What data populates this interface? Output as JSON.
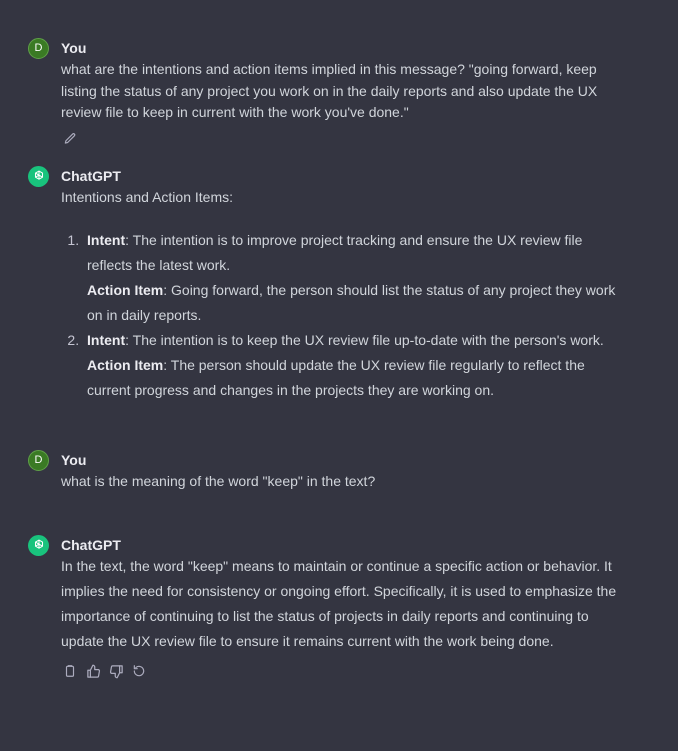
{
  "messages": [
    {
      "role": "user",
      "avatar_letter": "D",
      "author": "You",
      "text": "what are the intentions and action items implied in this message? \"going forward, keep listing the status of any project you work on in the daily reports and also update the UX review file to keep in current with the work you've done.\""
    },
    {
      "role": "assistant",
      "author": "ChatGPT",
      "intro": "Intentions and Action Items:",
      "items": [
        {
          "intent_label": "Intent",
          "intent_text": ": The intention is to improve project tracking and ensure the UX review file reflects the latest work.",
          "action_label": "Action Item",
          "action_text": ": Going forward, the person should list the status of any project they work on in daily reports."
        },
        {
          "intent_label": "Intent",
          "intent_text": ": The intention is to keep the UX review file up-to-date with the person's work.",
          "action_label": "Action Item",
          "action_text": ": The person should update the UX review file regularly to reflect the current progress and changes in the projects they are working on."
        }
      ]
    },
    {
      "role": "user",
      "avatar_letter": "D",
      "author": "You",
      "text": "what is the meaning of the word \"keep\" in the text?"
    },
    {
      "role": "assistant",
      "author": "ChatGPT",
      "text": "In the text, the word \"keep\" means to maintain or continue a specific action or behavior. It implies the need for consistency or ongoing effort. Specifically, it is used to emphasize the importance of continuing to list the status of projects in daily reports and continuing to update the UX review file to ensure it remains current with the work being done."
    }
  ],
  "icons": {
    "edit": "pencil-icon",
    "copy": "clipboard-icon",
    "like": "thumbs-up-icon",
    "dislike": "thumbs-down-icon",
    "regenerate": "regenerate-icon",
    "assistant_avatar": "openai-logo-icon"
  },
  "colors": {
    "background": "#343541",
    "user_avatar": "#3a7a24",
    "assistant_avatar": "#19c37d",
    "text": "#d1d5db"
  }
}
